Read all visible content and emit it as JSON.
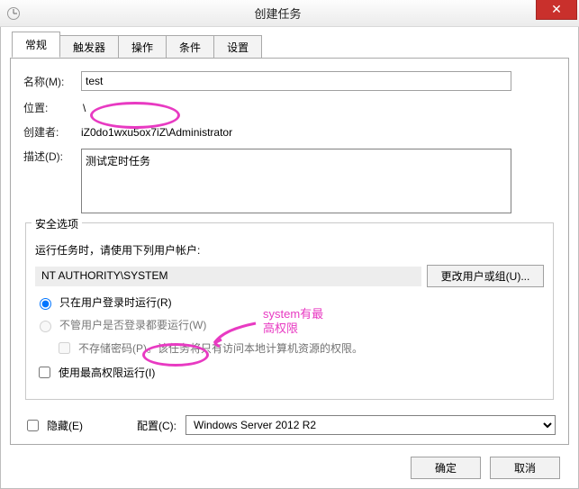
{
  "window": {
    "title": "创建任务",
    "close_tooltip": "Close"
  },
  "tabs": [
    {
      "label": "常规"
    },
    {
      "label": "触发器"
    },
    {
      "label": "操作"
    },
    {
      "label": "条件"
    },
    {
      "label": "设置"
    }
  ],
  "general": {
    "name_label": "名称(M):",
    "name_value": "test",
    "location_label": "位置:",
    "location_value": "\\",
    "creator_label": "创建者:",
    "creator_value": "iZ0do1wxu5ox7iZ\\Administrator",
    "desc_label": "描述(D):",
    "desc_value": "测试定时任务"
  },
  "security": {
    "legend": "安全选项",
    "run_as_label": "运行任务时，请使用下列用户帐户:",
    "account": "NT AUTHORITY\\SYSTEM",
    "change_user_btn": "更改用户或组(U)...",
    "radio_logged_on": "只在用户登录时运行(R)",
    "radio_any": "不管用户是否登录都要运行(W)",
    "no_store_pw": "不存储密码(P)。该任务将只有访问本地计算机资源的权限。",
    "highest_priv": "使用最高权限运行(I)"
  },
  "bottom": {
    "hidden": "隐藏(E)",
    "config_label": "配置(C):",
    "config_value": "Windows Server 2012 R2"
  },
  "buttons": {
    "ok": "确定",
    "cancel": "取消"
  },
  "annotation": {
    "line1": "system有最",
    "line2": "高权限"
  }
}
